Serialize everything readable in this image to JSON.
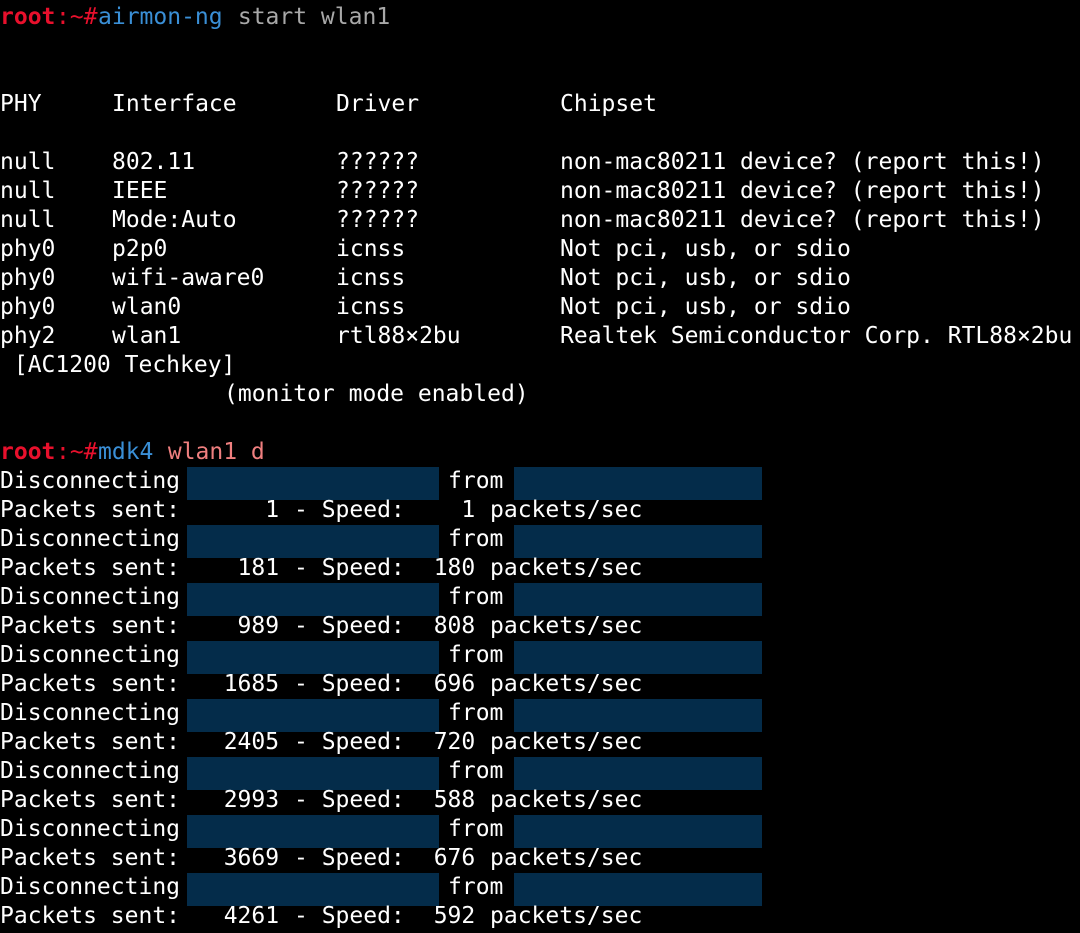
{
  "prompt1": {
    "user": "root",
    "sep": ":~#",
    "command": "airmon-ng",
    "args": " start wlan1"
  },
  "table": {
    "headers": [
      "PHY",
      "Interface",
      "Driver",
      "Chipset"
    ],
    "rows": [
      [
        "null",
        "802.11",
        "??????",
        "non-mac80211 device? (report this!)"
      ],
      [
        "null",
        "IEEE",
        "??????",
        "non-mac80211 device? (report this!)"
      ],
      [
        "null",
        "Mode:Auto",
        "??????",
        "non-mac80211 device? (report this!)"
      ],
      [
        "phy0",
        "p2p0",
        "icnss",
        "Not pci, usb, or sdio"
      ],
      [
        "phy0",
        "wifi-aware0",
        "icnss",
        "Not pci, usb, or sdio"
      ],
      [
        "phy0",
        "wlan0",
        "icnss",
        "Not pci, usb, or sdio"
      ],
      [
        "phy2",
        "wlan1",
        "rtl88×2bu",
        "Realtek Semiconductor Corp. RTL88×2bu"
      ]
    ],
    "continuation": " [AC1200 Techkey]",
    "status": "(monitor mode enabled)"
  },
  "prompt2": {
    "user": "root",
    "sep": ":~#",
    "command": "mdk4",
    "args": " wlan1 d"
  },
  "output": {
    "disc_label": "Disconnecting",
    "from_label": "from",
    "packets_label": "Packets sent:",
    "speed_label": "- Speed:",
    "unit_label": "packets/sec",
    "entries": [
      {
        "sent": "1",
        "speed": "1"
      },
      {
        "sent": "181",
        "speed": "180"
      },
      {
        "sent": "989",
        "speed": "808"
      },
      {
        "sent": "1685",
        "speed": "696"
      },
      {
        "sent": "2405",
        "speed": "720"
      },
      {
        "sent": "2993",
        "speed": "588"
      },
      {
        "sent": "3669",
        "speed": "676"
      },
      {
        "sent": "4261",
        "speed": "592"
      }
    ]
  },
  "colors": {
    "background": "#000000",
    "prompt_user": "#e8102c",
    "prompt_command": "#3a8fd6",
    "args_gray": "#a8a8a8",
    "args_salmon": "#ef7f7f",
    "redaction": "#042c4a"
  }
}
